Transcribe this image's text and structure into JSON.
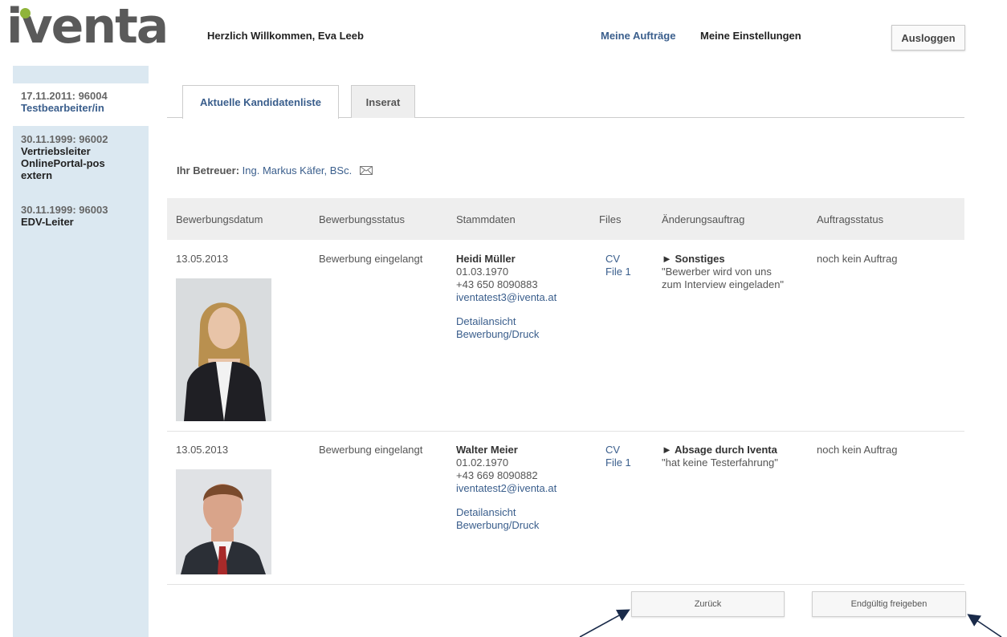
{
  "header": {
    "logo_text": "iventa",
    "welcome": "Herzlich Willkommen, Eva Leeb",
    "nav_orders": "Meine Aufträge",
    "nav_settings": "Meine Einstellungen",
    "logout": "Ausloggen",
    "brand_color": "#8fb43a"
  },
  "sidebar": {
    "items": [
      {
        "date": "17.11.2011: 96004",
        "title": "Testbearbeiter/in"
      },
      {
        "date": "30.11.1999: 96002",
        "title_lines": [
          "Vertriebsleiter",
          "OnlinePortal-pos",
          "extern"
        ]
      },
      {
        "date": "30.11.1999: 96003",
        "title": "EDV-Leiter"
      }
    ]
  },
  "tabs": [
    {
      "label": "Aktuelle Kandidatenliste"
    },
    {
      "label": "Inserat"
    }
  ],
  "betreuer": {
    "label": "Ihr Betreuer:",
    "name": "Ing. Markus Käfer, BSc."
  },
  "table": {
    "headers": [
      "Bewerbungsdatum",
      "Bewerbungsstatus",
      "Stammdaten",
      "Files",
      "Änderungsauftrag",
      "Auftragsstatus"
    ],
    "rows": [
      {
        "date": "13.05.2013",
        "status": "Bewerbung eingelangt",
        "name": "Heidi Müller",
        "birth": "01.03.1970",
        "phone": "+43 650 8090883",
        "email": "iventatest3@iventa.at",
        "detail": "Detailansicht",
        "print": "Bewerbung/Druck",
        "file_cv": "CV",
        "file_1": "File 1",
        "change_title": "► Sonstiges",
        "change_text_1": "\"Bewerber wird von uns",
        "change_text_2": "zum Interview eingeladen\"",
        "order_status": "noch kein Auftrag"
      },
      {
        "date": "13.05.2013",
        "status": "Bewerbung eingelangt",
        "name": "Walter Meier",
        "birth": "01.02.1970",
        "phone": "+43 669 8090882",
        "email": "iventatest2@iventa.at",
        "detail": "Detailansicht",
        "print": "Bewerbung/Druck",
        "file_cv": "CV",
        "file_1": "File 1",
        "change_title": "► Absage durch Iventa",
        "change_text_1": "\"hat keine Testerfahrung\"",
        "order_status": "noch kein Auftrag"
      }
    ]
  },
  "buttons": {
    "back": "Zurück",
    "release": "Endgültig freigeben"
  }
}
